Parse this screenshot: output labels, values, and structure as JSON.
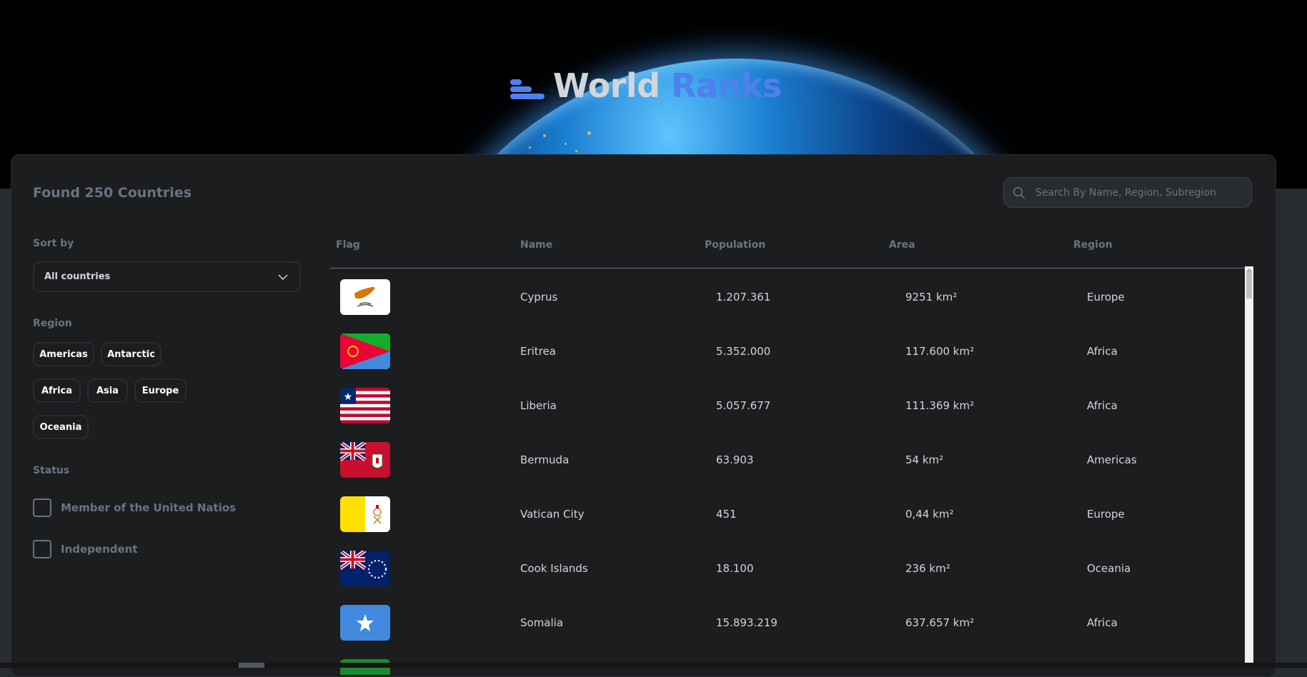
{
  "header": {
    "logo_icon": "ranking-bars-icon",
    "title_part1": "World",
    "title_part2": "Ranks",
    "colors": {
      "accent": "#4e80ee",
      "title": "#d2d5da"
    }
  },
  "summary": {
    "found_text": "Found 250 Countries"
  },
  "search": {
    "placeholder": "Search By Name, Region, Subregion",
    "value": "",
    "icon": "search-icon"
  },
  "filters": {
    "sort_label": "Sort by",
    "sort_selected": "All countries",
    "region_label": "Region",
    "regions": [
      "Americas",
      "Antarctic",
      "Africa",
      "Asia",
      "Europe",
      "Oceania"
    ],
    "status_label": "Status",
    "status_options": [
      {
        "label": "Member of the United Natios",
        "checked": false
      },
      {
        "label": "Independent",
        "checked": false
      }
    ]
  },
  "table": {
    "columns": [
      "Flag",
      "Name",
      "Population",
      "Area",
      "Region"
    ],
    "rows": [
      {
        "flag": "cyprus-flag",
        "name": "Cyprus",
        "population": "1.207.361",
        "area": "9251 km²",
        "region": "Europe"
      },
      {
        "flag": "eritrea-flag",
        "name": "Eritrea",
        "population": "5.352.000",
        "area": "117.600 km²",
        "region": "Africa"
      },
      {
        "flag": "liberia-flag",
        "name": "Liberia",
        "population": "5.057.677",
        "area": "111.369 km²",
        "region": "Africa"
      },
      {
        "flag": "bermuda-flag",
        "name": "Bermuda",
        "population": "63.903",
        "area": "54 km²",
        "region": "Americas"
      },
      {
        "flag": "vatican-city-flag",
        "name": "Vatican City",
        "population": "451",
        "area": "0,44 km²",
        "region": "Europe"
      },
      {
        "flag": "cook-islands-flag",
        "name": "Cook Islands",
        "population": "18.100",
        "area": "236 km²",
        "region": "Oceania"
      },
      {
        "flag": "somalia-flag",
        "name": "Somalia",
        "population": "15.893.219",
        "area": "637.657 km²",
        "region": "Africa"
      }
    ]
  }
}
